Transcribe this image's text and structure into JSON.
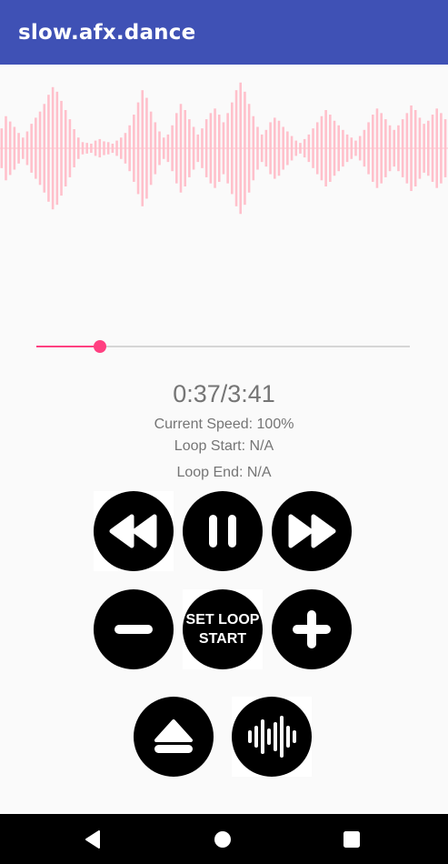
{
  "app": {
    "title": "slow.afx.dance"
  },
  "waveform": {
    "color": "#ffc0cb",
    "levels": [
      0.26,
      0.42,
      0.35,
      0.28,
      0.2,
      0.14,
      0.22,
      0.32,
      0.4,
      0.48,
      0.58,
      0.7,
      0.8,
      0.74,
      0.62,
      0.5,
      0.38,
      0.25,
      0.14,
      0.08,
      0.07,
      0.06,
      0.1,
      0.12,
      0.09,
      0.08,
      0.06,
      0.1,
      0.14,
      0.2,
      0.3,
      0.44,
      0.6,
      0.76,
      0.66,
      0.48,
      0.34,
      0.22,
      0.14,
      0.18,
      0.3,
      0.46,
      0.58,
      0.5,
      0.38,
      0.28,
      0.18,
      0.26,
      0.38,
      0.46,
      0.52,
      0.44,
      0.34,
      0.46,
      0.6,
      0.76,
      0.86,
      0.74,
      0.58,
      0.42,
      0.28,
      0.18,
      0.24,
      0.34,
      0.4,
      0.36,
      0.28,
      0.22,
      0.16,
      0.1,
      0.07,
      0.12,
      0.18,
      0.26,
      0.34,
      0.42,
      0.5,
      0.44,
      0.36,
      0.3,
      0.24,
      0.18,
      0.14,
      0.1,
      0.16,
      0.24,
      0.34,
      0.44,
      0.52,
      0.46,
      0.38,
      0.3,
      0.24,
      0.3,
      0.38,
      0.46,
      0.56,
      0.5,
      0.4,
      0.32,
      0.36,
      0.44,
      0.52,
      0.46,
      0.38
    ]
  },
  "seek": {
    "progress": 0.17,
    "track_color": "#d6d6d6",
    "fill_color": "#ff4081"
  },
  "player": {
    "time": "0:37/3:41",
    "speed": "Current Speed: 100%",
    "loop_start": "Loop Start: N/A",
    "loop_end": "Loop End: N/A"
  },
  "controls": {
    "rewind_icon": "rewind-icon",
    "pause_icon": "pause-icon",
    "fast_forward_icon": "fast-forward-icon",
    "decrease_icon": "minus-icon",
    "set_loop_label": "SET LOOP START",
    "increase_icon": "plus-icon",
    "eject_icon": "eject-icon",
    "waveform_icon": "waveform-icon"
  },
  "navbar": {
    "back": "back-icon",
    "home": "home-icon",
    "recents": "recents-icon"
  }
}
